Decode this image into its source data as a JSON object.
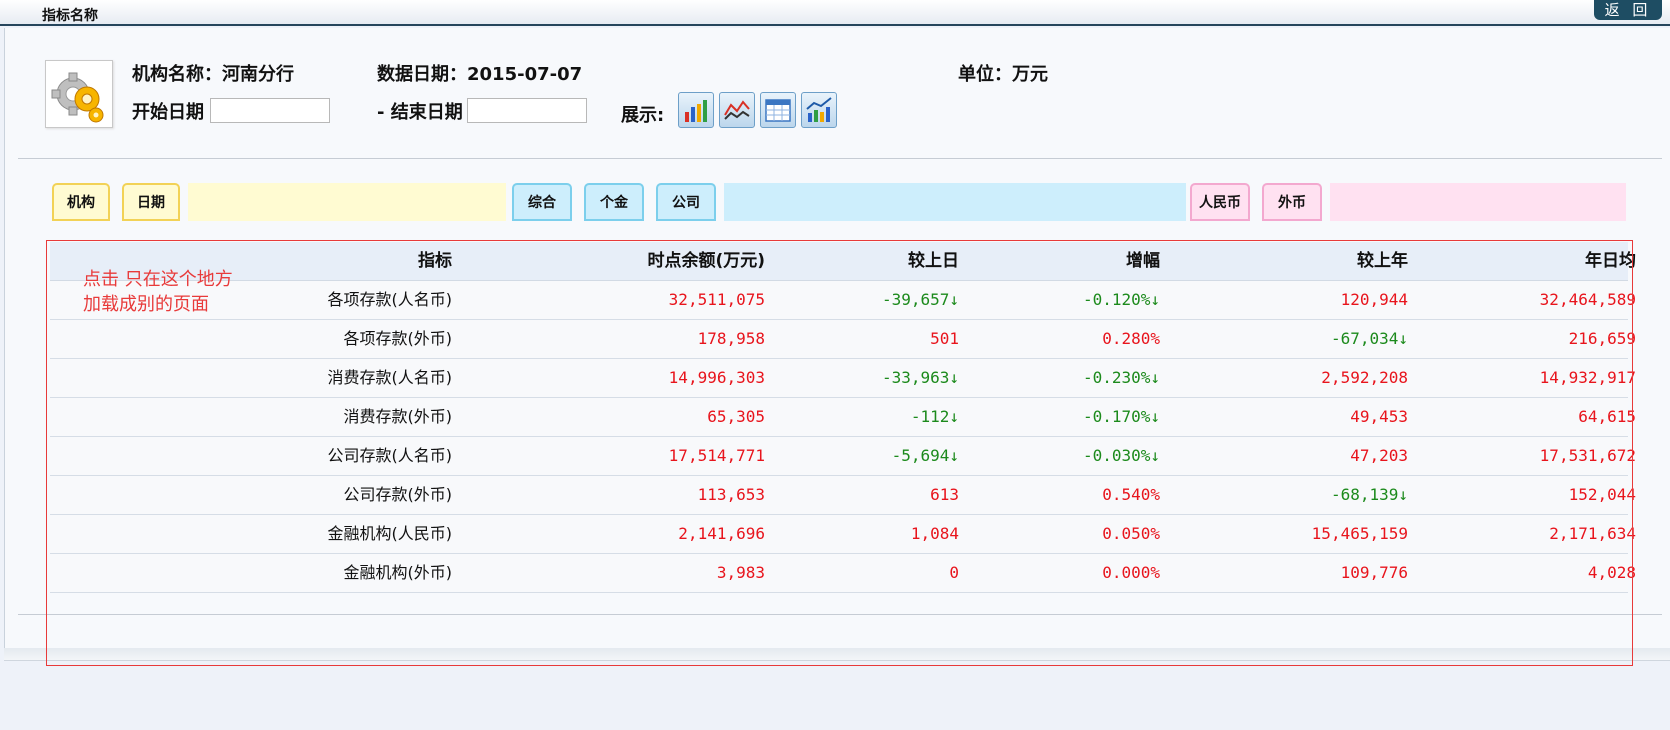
{
  "titlebar": {
    "title": "指标名称",
    "back_label": "返 回"
  },
  "header": {
    "icon": "gear-icon",
    "institution": "机构名称：河南分行",
    "data_date": "数据日期：2015-07-07",
    "unit": "单位：万元",
    "start_label": "开始日期",
    "start_value": "",
    "end_label": "- 结束日期",
    "end_value": "",
    "display_label": "展示:",
    "display_icons": [
      "bar-chart-icon",
      "line-chart-icon",
      "calendar-table-icon",
      "combo-chart-icon"
    ]
  },
  "tabs": {
    "yellow": [
      "机构",
      "日期"
    ],
    "blue": [
      "综合",
      "个金",
      "公司"
    ],
    "pink": [
      "人民币",
      "外币"
    ]
  },
  "colors": {
    "accent": "#1e4d63",
    "positive": "#e8141c",
    "negative": "#1c8a1c",
    "annotation": "#e83a3a"
  },
  "table": {
    "columns": [
      "指标",
      "时点余额(万元)",
      "较上日",
      "增幅",
      "较上年",
      "年日均"
    ],
    "rows": [
      {
        "cells": [
          "各项存款(人名币)",
          "32,511,075",
          "-39,657↓",
          "-0.120%↓",
          "120,944",
          "32,464,589"
        ],
        "tones": [
          "",
          "red",
          "green",
          "green",
          "red",
          "red"
        ]
      },
      {
        "cells": [
          "各项存款(外币)",
          "178,958",
          "501",
          "0.280%",
          "-67,034↓",
          "216,659"
        ],
        "tones": [
          "",
          "red",
          "red",
          "red",
          "green",
          "red"
        ]
      },
      {
        "cells": [
          "消费存款(人名币)",
          "14,996,303",
          "-33,963↓",
          "-0.230%↓",
          "2,592,208",
          "14,932,917"
        ],
        "tones": [
          "",
          "red",
          "green",
          "green",
          "red",
          "red"
        ]
      },
      {
        "cells": [
          "消费存款(外币)",
          "65,305",
          "-112↓",
          "-0.170%↓",
          "49,453",
          "64,615"
        ],
        "tones": [
          "",
          "red",
          "green",
          "green",
          "red",
          "red"
        ]
      },
      {
        "cells": [
          "公司存款(人名币)",
          "17,514,771",
          "-5,694↓",
          "-0.030%↓",
          "47,203",
          "17,531,672"
        ],
        "tones": [
          "",
          "red",
          "green",
          "green",
          "red",
          "red"
        ]
      },
      {
        "cells": [
          "公司存款(外币)",
          "113,653",
          "613",
          "0.540%",
          "-68,139↓",
          "152,044"
        ],
        "tones": [
          "",
          "red",
          "red",
          "red",
          "green",
          "red"
        ]
      },
      {
        "cells": [
          "金融机构(人民币)",
          "2,141,696",
          "1,084",
          "0.050%",
          "15,465,159",
          "2,171,634"
        ],
        "tones": [
          "",
          "red",
          "red",
          "red",
          "red",
          "red"
        ]
      },
      {
        "cells": [
          "金融机构(外币)",
          "3,983",
          "0",
          "0.000%",
          "109,776",
          "4,028"
        ],
        "tones": [
          "",
          "red",
          "red",
          "red",
          "red",
          "red"
        ]
      }
    ]
  },
  "annotation": {
    "text": "点击 只在这个地方\n加载成别的页面"
  }
}
